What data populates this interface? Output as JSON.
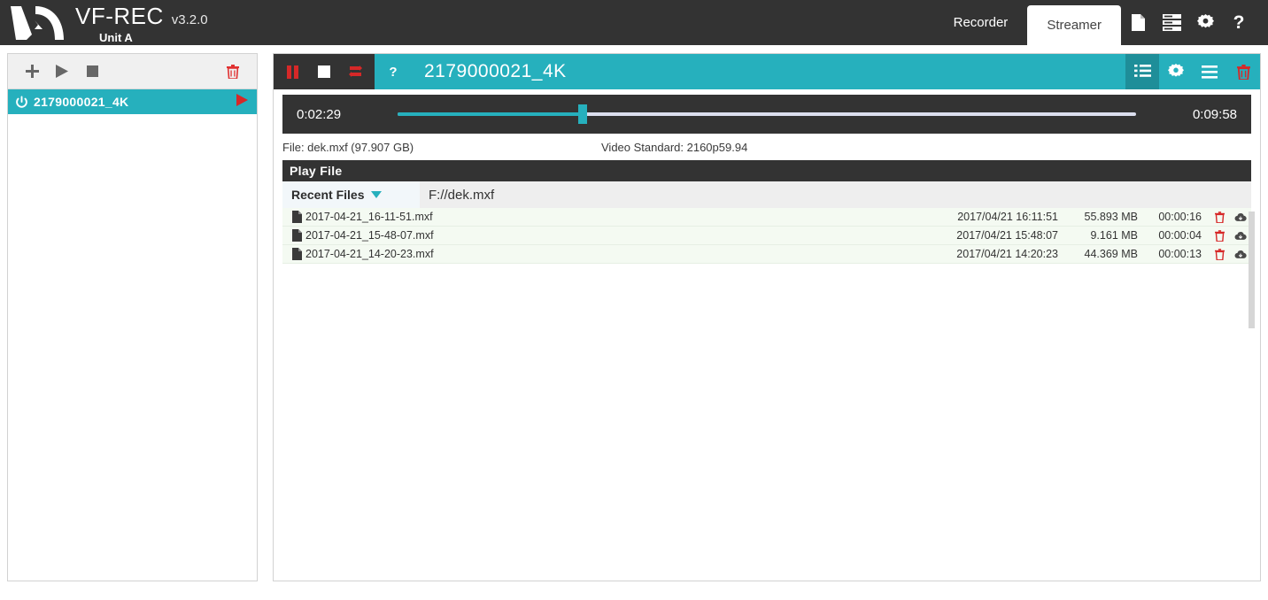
{
  "app": {
    "logo_icon": "va-logo-icon",
    "name": "VF-REC",
    "version": "v3.2.0",
    "unit": "Unit A",
    "accent_color": "#26b0bd",
    "accent_dark_color": "#1e8e99",
    "dark_color": "#333333",
    "danger_color": "#e03131"
  },
  "topnav": {
    "tabs": [
      {
        "label": "Recorder",
        "active": false
      },
      {
        "label": "Streamer",
        "active": true
      }
    ],
    "icons": [
      {
        "name": "page-icon",
        "glyph": "page"
      },
      {
        "name": "server-list-icon",
        "glyph": "server"
      },
      {
        "name": "gear-icon",
        "glyph": "gear"
      },
      {
        "name": "help-icon",
        "glyph": "?"
      }
    ]
  },
  "sidebar": {
    "toolbar": [
      {
        "name": "add-device-button",
        "glyph": "plus"
      },
      {
        "name": "play-button",
        "glyph": "play"
      },
      {
        "name": "stop-button",
        "glyph": "stop"
      },
      {
        "name": "delete-button",
        "glyph": "trash"
      }
    ],
    "devices": [
      {
        "power_icon": "power-icon",
        "label": "2179000021_4K",
        "play_icon": "play-icon",
        "selected": true
      }
    ]
  },
  "main": {
    "header": {
      "transport": [
        {
          "name": "pause-button",
          "glyph": "pause"
        },
        {
          "name": "stop-button",
          "glyph": "stop"
        },
        {
          "name": "loop-button",
          "glyph": "loop"
        }
      ],
      "help_label": "?",
      "title": "2179000021_4K",
      "right_icons": [
        {
          "name": "playlist-icon",
          "glyph": "ordered-list",
          "active": true
        },
        {
          "name": "settings-icon",
          "glyph": "gear",
          "active": false
        },
        {
          "name": "list-icon",
          "glyph": "list",
          "active": false
        },
        {
          "name": "delete-icon",
          "glyph": "trash",
          "active": false
        }
      ]
    },
    "timeline": {
      "current_time": "0:02:29",
      "total_time": "0:09:58",
      "progress_percent": 25
    },
    "info": {
      "file_label": "File: dek.mxf (97.907 GB)",
      "video_standard_label": "Video Standard: 2160p59.94"
    },
    "play_file": {
      "section_title": "Play File",
      "dropdown_label": "Recent Files",
      "dropdown_icon": "chevron-down-icon",
      "path_value": "F://dek.mxf",
      "files": [
        {
          "icon": "file-icon",
          "name": "2017-04-21_16-11-51.mxf",
          "date": "2017/04/21 16:11:51",
          "size": "55.893 MB",
          "duration": "00:00:16",
          "delete_icon": "trash-icon",
          "download_icon": "cloud-download-icon"
        },
        {
          "icon": "file-icon",
          "name": "2017-04-21_15-48-07.mxf",
          "date": "2017/04/21 15:48:07",
          "size": "9.161 MB",
          "duration": "00:00:04",
          "delete_icon": "trash-icon",
          "download_icon": "cloud-download-icon"
        },
        {
          "icon": "file-icon",
          "name": "2017-04-21_14-20-23.mxf",
          "date": "2017/04/21 14:20:23",
          "size": "44.369 MB",
          "duration": "00:00:13",
          "delete_icon": "trash-icon",
          "download_icon": "cloud-download-icon"
        }
      ]
    }
  }
}
